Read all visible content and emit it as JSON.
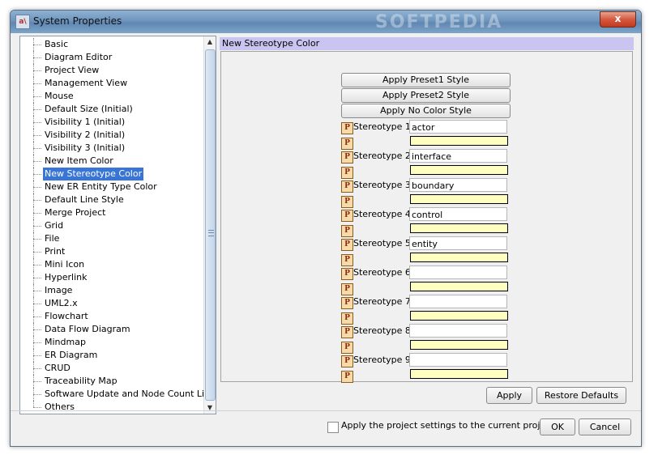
{
  "window": {
    "title": "System Properties",
    "app_icon": "app-icon",
    "watermark": "SOFTPEDIA",
    "close_glyph": "x"
  },
  "tree": {
    "items": [
      {
        "label": "Basic"
      },
      {
        "label": "Diagram Editor"
      },
      {
        "label": "Project View"
      },
      {
        "label": "Management View"
      },
      {
        "label": "Mouse"
      },
      {
        "label": "Default Size (Initial)"
      },
      {
        "label": "Visibility 1 (Initial)"
      },
      {
        "label": "Visibility 2 (Initial)"
      },
      {
        "label": "Visibility 3 (Initial)"
      },
      {
        "label": "New Item Color"
      },
      {
        "label": "New Stereotype Color",
        "selected": true
      },
      {
        "label": "New ER Entity Type Color"
      },
      {
        "label": "Default Line Style"
      },
      {
        "label": "Merge Project"
      },
      {
        "label": "Grid"
      },
      {
        "label": "File"
      },
      {
        "label": "Print"
      },
      {
        "label": "Mini Icon"
      },
      {
        "label": "Hyperlink"
      },
      {
        "label": "Image"
      },
      {
        "label": "UML2.x"
      },
      {
        "label": "Flowchart"
      },
      {
        "label": "Data Flow Diagram"
      },
      {
        "label": "Mindmap"
      },
      {
        "label": "ER Diagram"
      },
      {
        "label": "CRUD"
      },
      {
        "label": "Traceability Map"
      },
      {
        "label": "Software Update and Node Count License"
      },
      {
        "label": "Others"
      }
    ]
  },
  "panel": {
    "title": "New Stereotype Color",
    "presets": [
      "Apply Preset1 Style",
      "Apply Preset2 Style",
      "Apply No Color Style"
    ],
    "icon_glyph": "P",
    "stereotypes": [
      {
        "label": "Stereotype 1",
        "value": "actor"
      },
      {
        "label": "Stereotype 2",
        "value": "interface"
      },
      {
        "label": "Stereotype 3",
        "value": "boundary"
      },
      {
        "label": "Stereotype 4",
        "value": "control"
      },
      {
        "label": "Stereotype 5",
        "value": "entity"
      },
      {
        "label": "Stereotype 6",
        "value": ""
      },
      {
        "label": "Stereotype 7",
        "value": ""
      },
      {
        "label": "Stereotype 8",
        "value": ""
      },
      {
        "label": "Stereotype 9",
        "value": ""
      }
    ],
    "swatch_color": "#ffffc0",
    "apply_label": "Apply",
    "restore_label": "Restore Defaults"
  },
  "footer": {
    "checkbox_label": "Apply the project settings to the current project",
    "checkbox_checked": false,
    "ok_label": "OK",
    "cancel_label": "Cancel"
  },
  "colors": {
    "selection": "#3875d7",
    "panel_header": "#c8c6f0",
    "titlebar": "#6f95bd",
    "close_button": "#c23a1f"
  }
}
